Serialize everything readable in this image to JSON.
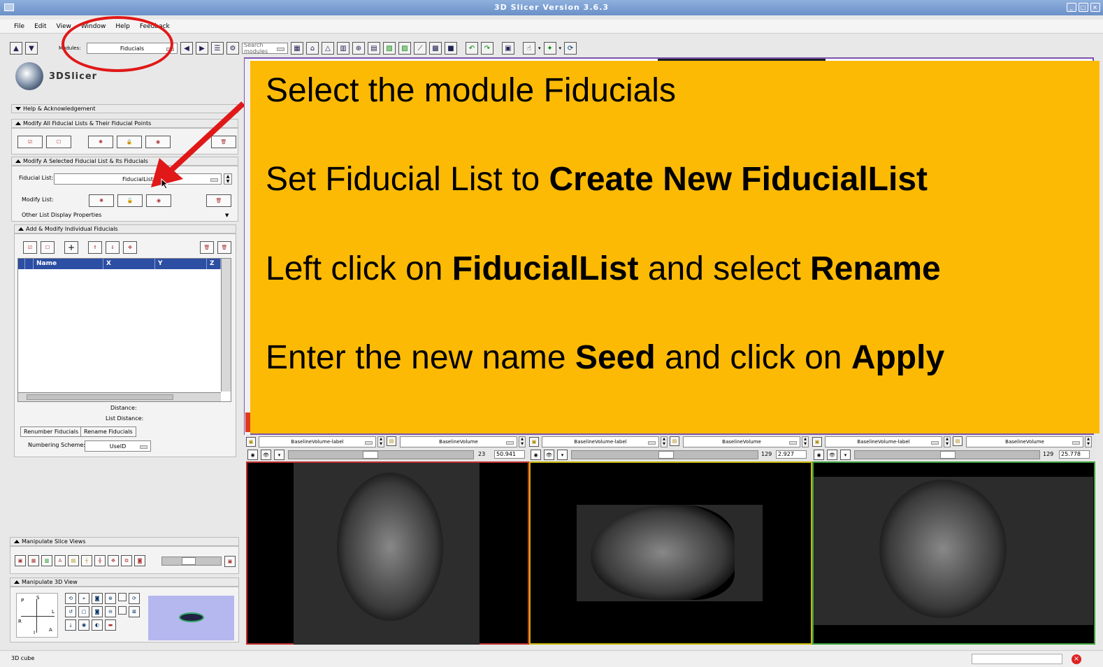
{
  "window": {
    "title": "3D Slicer Version 3.6.3",
    "controls": [
      "minimize-icon",
      "maximize-icon",
      "close-icon"
    ]
  },
  "menu": [
    "File",
    "Edit",
    "View",
    "Window",
    "Help",
    "Feedback"
  ],
  "toolbar": {
    "modules_label": "Modules:",
    "module_value": "Fiducials",
    "search_placeholder": "Search modules"
  },
  "logo": {
    "text": "3DSlicer"
  },
  "sections": {
    "help": "Help & Acknowledgement",
    "modify_all": "Modify All Fiducial Lists & Their Fiducial Points",
    "modify_selected": "Modify A Selected Fiducial List & Its Fiducials",
    "fiducial_list_label": "Fiducial List:",
    "fiducial_list_value": "FiducialList",
    "modify_list_label": "Modify List:",
    "other_props": "Other List Display Properties",
    "add_modify": "Add & Modify Individual Fiducials",
    "table_headers": [
      "Name",
      "X",
      "Y",
      "Z"
    ],
    "distance": "Distance:",
    "list_distance": "List Distance:",
    "renumber_btn": "Renumber Fiducials",
    "rename_btn": "Rename Fiducials",
    "numbering_label": "Numbering Scheme:",
    "numbering_value": "UseID",
    "manip_slice": "Manipulate Slice Views",
    "manip_3d": "Manipulate 3D View"
  },
  "orientation": [
    "P",
    "S",
    "R",
    "L",
    "I",
    "A"
  ],
  "instructions": [
    {
      "plain": "Select the module Fiducials",
      "bold": "",
      "plain2": "",
      "bold2": ""
    },
    {
      "plain": "Set Fiducial List to ",
      "bold": "Create New FiducialList",
      "plain2": "",
      "bold2": ""
    },
    {
      "plain": "Left click on ",
      "bold": "FiducialList",
      "plain2": " and select ",
      "bold2": "Rename"
    },
    {
      "plain": "Enter the new name ",
      "bold": "Seed",
      "plain2": " and click on ",
      "bold2": "Apply"
    }
  ],
  "slice_views": [
    {
      "label_volume": "BaselineVolume-label",
      "volume": "BaselineVolume",
      "slice_index": "23",
      "offset": "50.941",
      "border": "#c03030"
    },
    {
      "label_volume": "BaselineVolume-label",
      "volume": "BaselineVolume",
      "slice_index": "129",
      "offset": "2.927",
      "border": "#c8b800"
    },
    {
      "label_volume": "BaselineVolume-label",
      "volume": "BaselineVolume",
      "slice_index": "129",
      "offset": "25.778",
      "border": "#40a040"
    }
  ],
  "status": {
    "text": "3D cube"
  },
  "colors": {
    "banner": "#fcba04",
    "annotation": "#e01818",
    "table_header": "#2c4ea3"
  }
}
